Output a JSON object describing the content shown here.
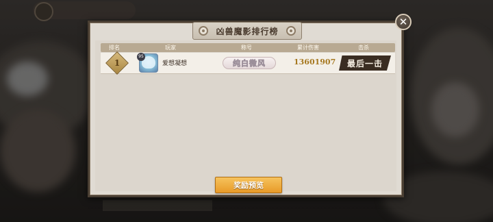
{
  "dialog": {
    "title": "凶兽魔影排行榜",
    "close_icon": "close-icon"
  },
  "table": {
    "headers": [
      "排名",
      "玩家",
      "称号",
      "累计伤害",
      "击杀"
    ],
    "rows": [
      {
        "rank": "1",
        "avatar_level": "95",
        "player": "爱想凝想",
        "title": "纯白微风",
        "damage": "13601907",
        "kill": "最后一击"
      }
    ]
  },
  "footer": {
    "reward_button": "奖励预览"
  },
  "colors": {
    "panel": "#e0dbd3",
    "header": "#b8a992",
    "button": "#e89a28",
    "damage": "#a6781f"
  }
}
